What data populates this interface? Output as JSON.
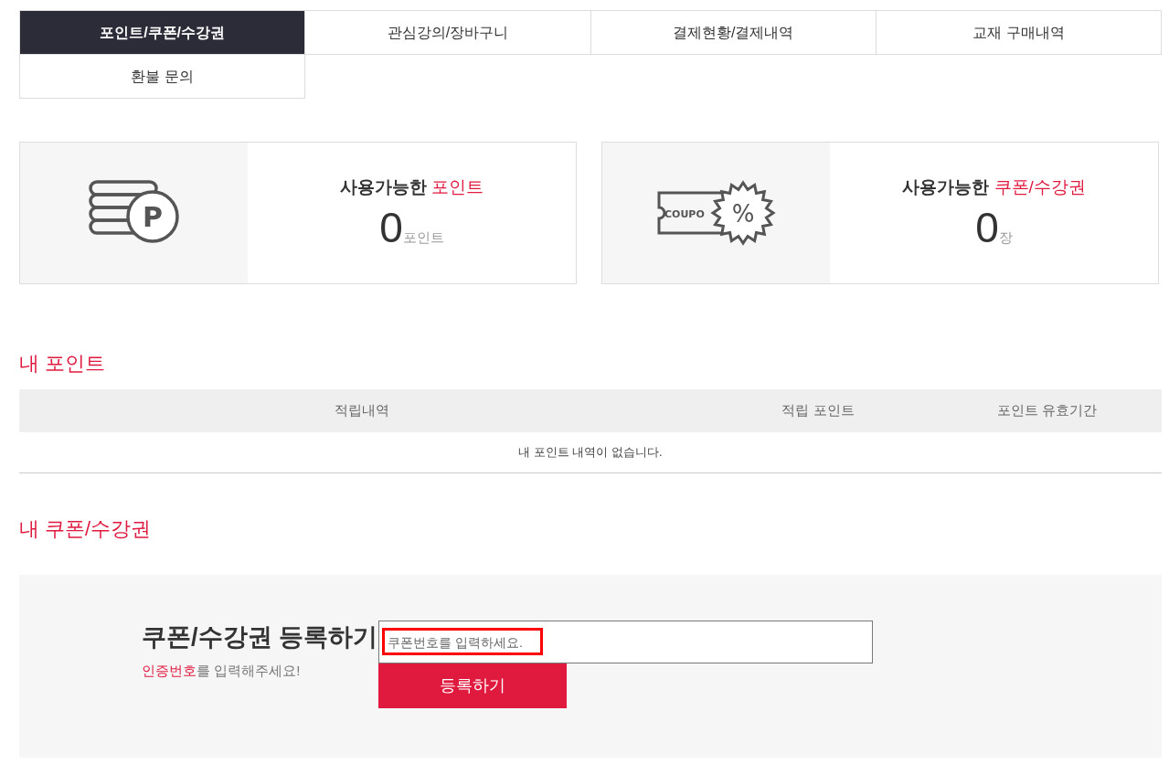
{
  "tabs": [
    {
      "label": "포인트/쿠폰/수강권",
      "selected": true
    },
    {
      "label": "관심강의/장바구니",
      "selected": false
    },
    {
      "label": "결제현황/결제내역",
      "selected": false
    },
    {
      "label": "교재 구매내역",
      "selected": false
    },
    {
      "label": "환불 문의",
      "selected": false
    }
  ],
  "summary_cards": [
    {
      "kind": "points",
      "icon_text": "P",
      "title": "사용가능한 ",
      "title_highlight": "포인트",
      "value": "0",
      "unit": "포인트"
    },
    {
      "kind": "coupons",
      "icon_text": "COUPO",
      "icon_symbol": "%",
      "title": "사용가능한 ",
      "title_highlight": "쿠폰/수강권",
      "value": "0",
      "unit": "장"
    }
  ],
  "points_section": {
    "title": "내 포인트",
    "columns": [
      "적립내역",
      "적립 포인트",
      "포인트 유효기간"
    ],
    "empty_message": "내 포인트 내역이 없습니다."
  },
  "coupon_section": {
    "title": "내 쿠폰/수강권",
    "register_title": "쿠폰/수강권 등록하기",
    "help_highlight": "인증번호",
    "help_rest": "를 입력해주세요!",
    "input": {
      "placeholder": "쿠폰번호를 입력하세요.",
      "highlighted": true
    },
    "button": "등록하기"
  }
}
